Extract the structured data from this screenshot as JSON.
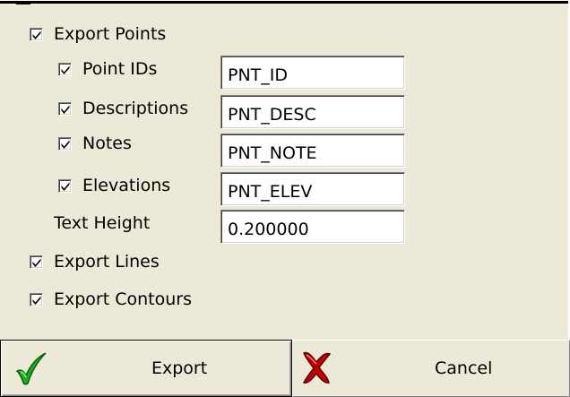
{
  "options": {
    "export_points": {
      "label": "Export Points",
      "checked": true
    },
    "point_ids": {
      "label": "Point IDs",
      "checked": true,
      "value": "PNT_ID"
    },
    "descriptions": {
      "label": "Descriptions",
      "checked": true,
      "value": "PNT_DESC"
    },
    "notes": {
      "label": "Notes",
      "checked": true,
      "value": "PNT_NOTE"
    },
    "elevations": {
      "label": "Elevations",
      "checked": true,
      "value": "PNT_ELEV"
    },
    "text_height": {
      "label": "Text Height",
      "value": "0.200000"
    },
    "export_lines": {
      "label": "Export Lines",
      "checked": true
    },
    "export_contours": {
      "label": "Export Contours",
      "checked": true
    }
  },
  "buttons": {
    "export": {
      "label": "Export",
      "icon": "green-checkmark-icon",
      "color": "#1FA91F"
    },
    "cancel": {
      "label": "Cancel",
      "icon": "red-x-icon",
      "color": "#C00000"
    }
  }
}
